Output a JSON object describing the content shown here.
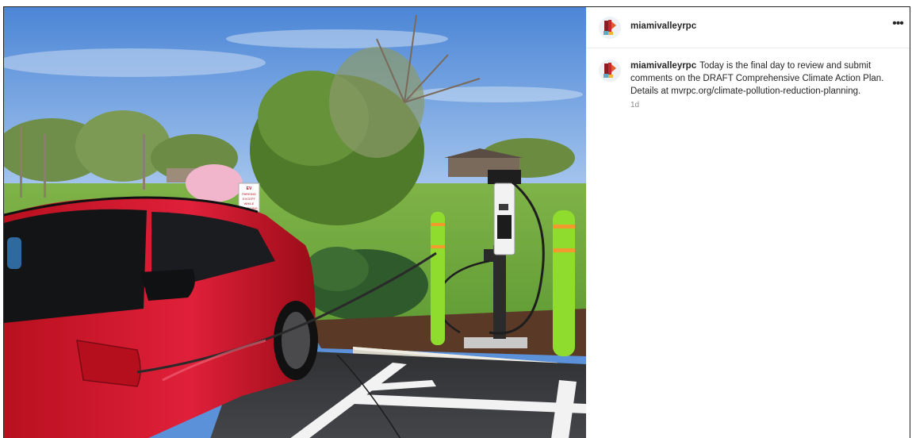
{
  "post": {
    "username": "miamivalleyrpc",
    "caption": "Today is the final day to review and submit comments on the DRAFT Comprehensive Climate Action Plan. Details at mvrpc.org/climate-pollution-reduction-planning.",
    "time": "1d",
    "more_label": "•••"
  },
  "photo": {
    "sign_text_1": "EV",
    "sign_text_2": "PARKING",
    "sign_text_3": "EXCEPT",
    "sign_text_4": "WHILE",
    "sign_text_5": "CHARGING"
  },
  "colors": {
    "sky": "#5a91d8",
    "grass": "#6aa23a",
    "car_red": "#d2162c",
    "bollard": "#8fdc2e",
    "asphalt": "#3a3b3d"
  }
}
